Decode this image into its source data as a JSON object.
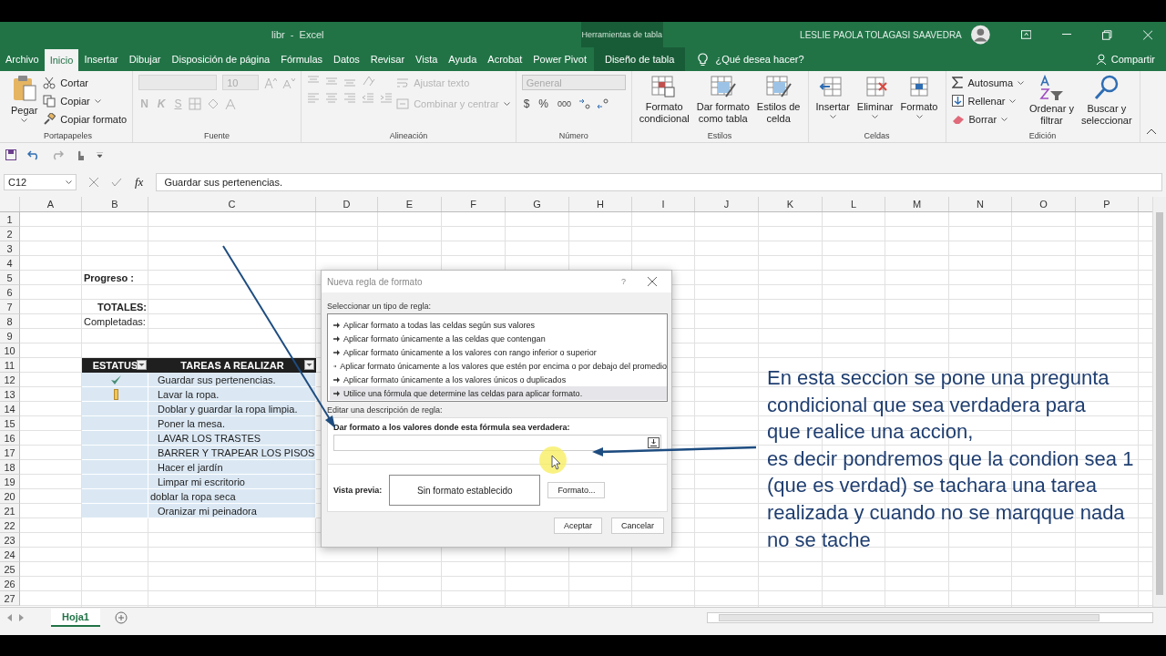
{
  "window": {
    "title": "libr  -  Excel",
    "context_label": "Herramientas de tabla",
    "user": "LESLIE PAOLA TOLAGASI SAAVEDRA"
  },
  "tabs": [
    {
      "label": "Archivo",
      "selected": false,
      "kind": "normal"
    },
    {
      "label": "Inicio",
      "selected": true,
      "kind": "normal"
    },
    {
      "label": "Insertar",
      "selected": false,
      "kind": "normal"
    },
    {
      "label": "Dibujar",
      "selected": false,
      "kind": "normal"
    },
    {
      "label": "Disposición de página",
      "selected": false,
      "kind": "normal"
    },
    {
      "label": "Fórmulas",
      "selected": false,
      "kind": "normal"
    },
    {
      "label": "Datos",
      "selected": false,
      "kind": "normal"
    },
    {
      "label": "Revisar",
      "selected": false,
      "kind": "normal"
    },
    {
      "label": "Vista",
      "selected": false,
      "kind": "normal"
    },
    {
      "label": "Ayuda",
      "selected": false,
      "kind": "normal"
    },
    {
      "label": "Acrobat",
      "selected": false,
      "kind": "normal"
    },
    {
      "label": "Power Pivot",
      "selected": false,
      "kind": "normal"
    },
    {
      "label": "Diseño de tabla",
      "selected": false,
      "kind": "contextual"
    }
  ],
  "search": {
    "placeholder": "¿Qué desea hacer?"
  },
  "share": "Compartir",
  "ribbon": {
    "clipboard": {
      "label": "Portapapeles",
      "paste": "Pegar",
      "cut": "Cortar",
      "copy": "Copiar",
      "format_painter": "Copiar formato"
    },
    "font": {
      "label": "Fuente",
      "size": "10",
      "bold": "N",
      "italic": "K",
      "underline": "S",
      "disabled": true
    },
    "alignment": {
      "label": "Alineación",
      "wrap": "Ajustar texto",
      "merge": "Combinar y centrar",
      "disabled": true
    },
    "number": {
      "label": "Número",
      "format": "General",
      "format_disabled": true,
      "currency": "$",
      "percent": "%",
      "thousands": "000"
    },
    "styles": {
      "label": "Estilos",
      "buttons": [
        {
          "lines": [
            "Formato",
            "condicional"
          ]
        },
        {
          "lines": [
            "Dar formato",
            "como tabla"
          ]
        },
        {
          "lines": [
            "Estilos de",
            "celda"
          ]
        }
      ]
    },
    "cells": {
      "label": "Celdas",
      "buttons": [
        {
          "lines": [
            "Insertar"
          ]
        },
        {
          "lines": [
            "Eliminar"
          ]
        },
        {
          "lines": [
            "Formato"
          ]
        }
      ]
    },
    "editing": {
      "label": "Edición",
      "small": [
        "Autosuma",
        "Rellenar",
        "Borrar"
      ],
      "big": [
        {
          "lines": [
            "Ordenar y",
            "filtrar"
          ]
        },
        {
          "lines": [
            "Buscar y",
            "seleccionar"
          ]
        }
      ]
    }
  },
  "formula_bar": {
    "name_box": "C12",
    "function_label": "fx",
    "value": "Guardar sus pertenencias."
  },
  "sheet": {
    "columns": [
      "A",
      "B",
      "C",
      "D",
      "E",
      "F",
      "G",
      "H",
      "I",
      "J",
      "K",
      "L",
      "M",
      "N",
      "O",
      "P"
    ],
    "rows": [
      {
        "number": "1",
        "kind": "blank"
      },
      {
        "number": "2",
        "kind": "blank"
      },
      {
        "number": "3",
        "kind": "blank"
      },
      {
        "number": "4",
        "kind": "blank"
      },
      {
        "number": "5",
        "kind": "title-label",
        "text": "Progreso :"
      },
      {
        "number": "6",
        "kind": "blank"
      },
      {
        "number": "7",
        "kind": "total-label",
        "text": "TOTALES:"
      },
      {
        "number": "8",
        "kind": "count-label",
        "text": "Completadas:"
      },
      {
        "number": "9",
        "kind": "blank"
      },
      {
        "number": "10",
        "kind": "blank"
      },
      {
        "number": "11",
        "kind": "header",
        "status_heading": "ESTATUS",
        "task_heading": "TAREAS A REALIZAR"
      },
      {
        "number": "12",
        "kind": "task",
        "done": true,
        "started": false,
        "text": "Guardar sus pertenencias.",
        "indent": true
      },
      {
        "number": "13",
        "kind": "task",
        "done": false,
        "started": true,
        "text": "Lavar la ropa.",
        "indent": true
      },
      {
        "number": "14",
        "kind": "task",
        "done": false,
        "started": false,
        "text": "Doblar y guardar la ropa limpia.",
        "indent": true
      },
      {
        "number": "15",
        "kind": "task",
        "done": false,
        "started": false,
        "text": "Poner la mesa.",
        "indent": true
      },
      {
        "number": "16",
        "kind": "task",
        "done": false,
        "started": false,
        "text": "LAVAR LOS TRASTES",
        "indent": true
      },
      {
        "number": "17",
        "kind": "task",
        "done": false,
        "started": false,
        "text": "BARRER Y TRAPEAR LOS PISOS",
        "indent": true
      },
      {
        "number": "18",
        "kind": "task",
        "done": false,
        "started": false,
        "text": "Hacer el jardín",
        "indent": true
      },
      {
        "number": "19",
        "kind": "task",
        "done": false,
        "started": false,
        "text": "Limpar mi escritorio",
        "indent": true
      },
      {
        "number": "20",
        "kind": "task",
        "done": false,
        "started": false,
        "text": "doblar la ropa seca",
        "indent": false
      },
      {
        "number": "21",
        "kind": "task",
        "done": false,
        "started": false,
        "text": "Oranizar mi peinadora",
        "indent": true
      },
      {
        "number": "22",
        "kind": "blank"
      },
      {
        "number": "23",
        "kind": "blank"
      },
      {
        "number": "24",
        "kind": "blank"
      },
      {
        "number": "25",
        "kind": "blank"
      },
      {
        "number": "26",
        "kind": "blank"
      },
      {
        "number": "27",
        "kind": "blank"
      }
    ]
  },
  "dialog": {
    "title": "Nueva regla de formato",
    "help": "?",
    "rule_type_label": "Seleccionar un tipo de regla:",
    "rule_types": [
      {
        "label": "Aplicar formato a todas las celdas según sus valores",
        "selected": false
      },
      {
        "label": "Aplicar formato únicamente a las celdas que contengan",
        "selected": false
      },
      {
        "label": "Aplicar formato únicamente a los valores con rango inferior o superior",
        "selected": false
      },
      {
        "label": "Aplicar formato únicamente a los valores que estén por encima o por debajo del promedio",
        "selected": false
      },
      {
        "label": "Aplicar formato únicamente a los valores únicos o duplicados",
        "selected": false
      },
      {
        "label": "Utilice una fórmula que determine las celdas para aplicar formato.",
        "selected": true
      }
    ],
    "description_label": "Editar una descripción de regla:",
    "formula_label": "Dar formato a los valores donde esta fórmula sea verdadera:",
    "preview_label": "Vista previa:",
    "preview": "Sin formato establecido",
    "format_button": "Formato...",
    "buttons": [
      "Aceptar",
      "Cancelar"
    ]
  },
  "annotation": {
    "lines": [
      "En esta seccion se pone una pregunta",
      "condicional que sea verdadera para",
      "que realice una accion,",
      "es decir pondremos que la condion sea 1",
      "(que es verdad) se tachara una tarea",
      "realizada y cuando no se marqque nada",
      "no se tache"
    ]
  },
  "sheet_tabs": [
    {
      "label": "Hoja1",
      "selected": true
    }
  ]
}
